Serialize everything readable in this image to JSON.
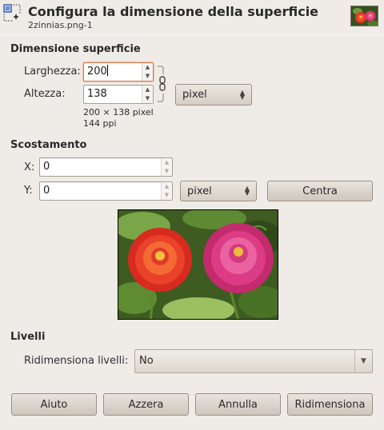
{
  "header": {
    "title": "Configura la dimensione della superficie",
    "subtitle": "2zinnias.png-1"
  },
  "size_section": {
    "title": "Dimensione superficie",
    "width_label": "Larghezza:",
    "width_value": "200",
    "height_label": "Altezza:",
    "height_value": "138",
    "unit": "pixel",
    "info_dims": "200 × 138 pixel",
    "info_res": "144 ppi"
  },
  "offset_section": {
    "title": "Scostamento",
    "x_label": "X:",
    "x_value": "0",
    "y_label": "Y:",
    "y_value": "0",
    "unit": "pixel",
    "center_button": "Centra"
  },
  "layers_section": {
    "title": "Livelli",
    "resize_label": "Ridimensiona livelli:",
    "resize_value": "No"
  },
  "buttons": {
    "help": "Aiuto",
    "reset": "Azzera",
    "cancel": "Annulla",
    "resize": "Ridimensiona"
  }
}
